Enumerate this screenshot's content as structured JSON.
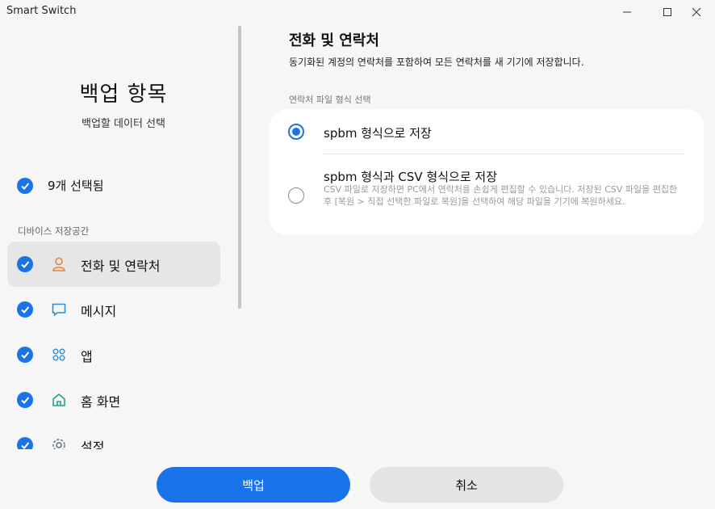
{
  "window": {
    "title": "Smart Switch",
    "controls": [
      "minimize",
      "maximize",
      "close"
    ]
  },
  "sidebar": {
    "title": "백업 항목",
    "subtitle": "백업할 데이터 선택",
    "selected_count": "9개 선택됨",
    "storage_label": "디바이스 저장공간",
    "items": [
      {
        "label": "전화 및 연락처",
        "icon": "person-icon",
        "checked": true,
        "active": true
      },
      {
        "label": "메시지",
        "icon": "message-icon",
        "checked": true,
        "active": false
      },
      {
        "label": "앱",
        "icon": "apps-grid-icon",
        "checked": true,
        "active": false
      },
      {
        "label": "홈 화면",
        "icon": "home-icon",
        "checked": true,
        "active": false
      },
      {
        "label": "설정",
        "icon": "settings-icon",
        "checked": true,
        "active": false
      }
    ]
  },
  "main": {
    "title": "전화 및 연락처",
    "description": "동기화된 계정의 연락처를 포함하여 모든 연락처를 새 기기에 저장합니다.",
    "format_label": "연락처 파일 형식 선택",
    "options": [
      {
        "label": "spbm 형식으로 저장",
        "selected": true
      },
      {
        "label": "spbm 형식과 CSV 형식으로 저장",
        "description": "CSV 파일로 저장하면 PC에서 연락처를 손쉽게 편집할 수 있습니다. 저장된 CSV 파일을 편집한 후 [복원 > 직접 선택한 파일로 복원]을 선택하여 해당 파일을 기기에 복원하세요.",
        "selected": false
      }
    ]
  },
  "footer": {
    "backup_label": "백업",
    "cancel_label": "취소"
  },
  "colors": {
    "accent": "#1a73e8",
    "background": "#f6f6f6",
    "card": "#ffffff",
    "active_item": "#e6e6e6"
  }
}
